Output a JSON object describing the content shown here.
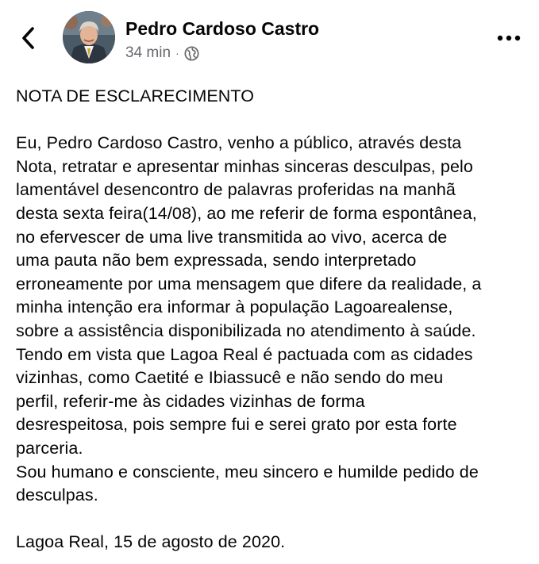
{
  "header": {
    "author_name": "Pedro Cardoso Castro",
    "time_ago": "34 min",
    "separator": "·",
    "audience_icon": "globe-icon",
    "back_icon": "chevron-left-icon",
    "more_icon": "more-horizontal-icon"
  },
  "post": {
    "title": "NOTA DE ESCLARECIMENTO",
    "paragraph_1_lines": [
      "Eu, Pedro Cardoso Castro, venho a público, através desta",
      "Nota, retratar e apresentar minhas sinceras desculpas, pelo",
      "lamentável desencontro de palavras proferidas na manhã",
      "desta sexta feira(14/08), ao me referir de forma espontânea,",
      "no efervescer de uma live transmitida ao vivo, acerca de",
      "uma pauta não bem expressada, sendo interpretado",
      "erroneamente por uma mensagem que difere da realidade, a",
      "minha intenção era informar à população Lagoarealense,",
      "sobre a assistência disponibilizada no atendimento à saúde.",
      "Tendo em vista que Lagoa Real é pactuada com as cidades",
      "vizinhas, como Caetité e Ibiassucê e não sendo do meu",
      "perfil, referir-me às cidades vizinhas de forma",
      "desrespeitosa, pois sempre fui e serei grato por esta forte",
      "parceria."
    ],
    "paragraph_2_lines": [
      "Sou humano e consciente, meu sincero e humilde pedido de",
      "desculpas."
    ],
    "signature": "Lagoa Real, 15 de agosto de 2020."
  },
  "colors": {
    "text": "#050505",
    "secondary_text": "#65676b",
    "background": "#ffffff"
  }
}
